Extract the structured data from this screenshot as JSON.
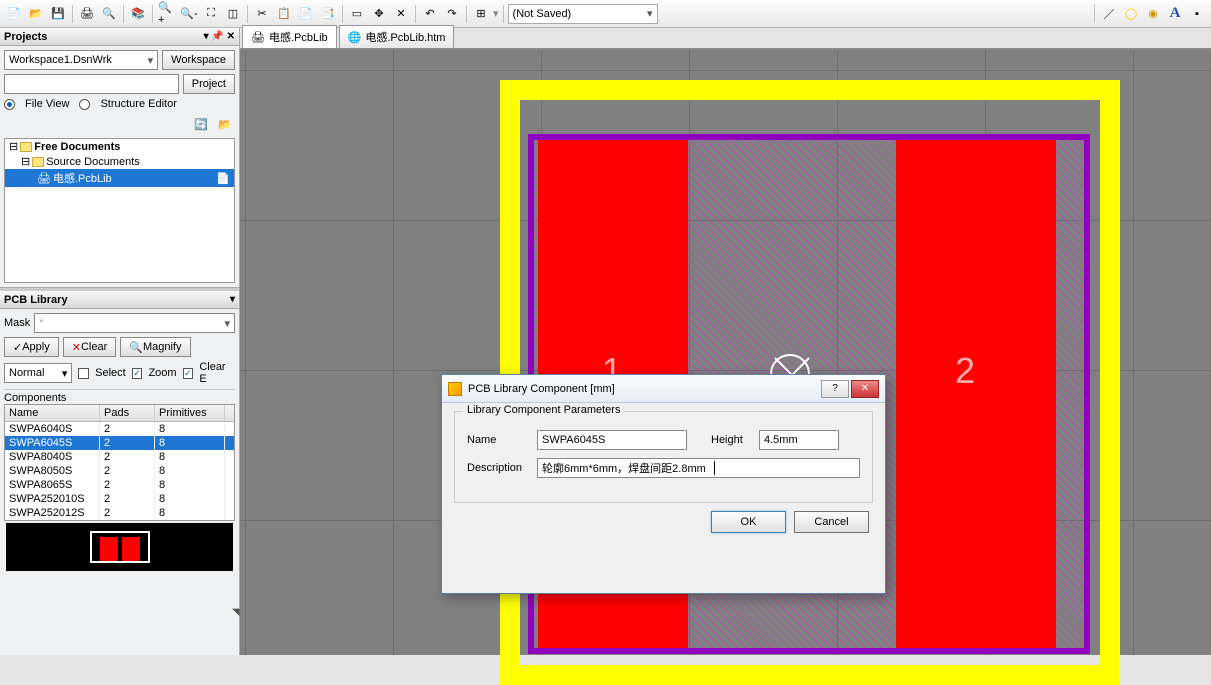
{
  "toolbar": {
    "save_state": "(Not Saved)"
  },
  "projects": {
    "title": "Projects",
    "workspace_dropdown": "Workspace1.DsnWrk",
    "workspace_btn": "Workspace",
    "project_btn": "Project",
    "file_view": "File View",
    "structure_editor": "Structure Editor",
    "tree": {
      "root": "Free Documents",
      "sub": "Source Documents",
      "file": "电感.PcbLib"
    }
  },
  "pcblib": {
    "title": "PCB Library",
    "mask_label": "Mask",
    "mask_value": "",
    "apply": "Apply",
    "clear": "Clear",
    "magnify": "Magnify",
    "mode": "Normal",
    "select": "Select",
    "zoom": "Zoom",
    "clear_e": "Clear E",
    "components_label": "Components",
    "columns": {
      "c1": "Name",
      "c2": "Pads",
      "c3": "Primitives"
    },
    "rows": [
      {
        "name": "SWPA6040S",
        "pads": "2",
        "prims": "8"
      },
      {
        "name": "SWPA6045S",
        "pads": "2",
        "prims": "8"
      },
      {
        "name": "SWPA8040S",
        "pads": "2",
        "prims": "8"
      },
      {
        "name": "SWPA8050S",
        "pads": "2",
        "prims": "8"
      },
      {
        "name": "SWPA8065S",
        "pads": "2",
        "prims": "8"
      },
      {
        "name": "SWPA252010S",
        "pads": "2",
        "prims": "8"
      },
      {
        "name": "SWPA252012S",
        "pads": "2",
        "prims": "8"
      }
    ]
  },
  "tabs": {
    "tab1": "电感.PcbLib",
    "tab2": "电感.PcbLib.htm"
  },
  "canvas": {
    "pad1_label": "1",
    "pad2_label": "2"
  },
  "dialog": {
    "title": "PCB Library Component [mm]",
    "group_title": "Library Component Parameters",
    "name_label": "Name",
    "name_value": "SWPA6045S",
    "height_label": "Height",
    "height_value": "4.5mm",
    "desc_label": "Description",
    "desc_value": "轮廓6mm*6mm，焊盘间距2.8mm",
    "ok": "OK",
    "cancel": "Cancel"
  }
}
